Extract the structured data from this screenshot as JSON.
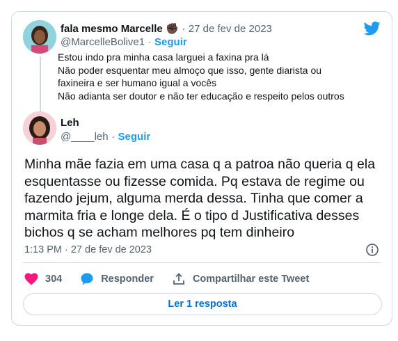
{
  "parent": {
    "name": "fala mesmo Marcelle",
    "emoji": "✊🏿",
    "date": "27 de fev de 2023",
    "handle": "@MarcelleBolive1",
    "follow": "Seguir",
    "lines": [
      "Estou indo pra minha casa larguei a faxina pra lá",
      "Não poder esquentar meu almoço que isso, gente diarista ou",
      "faxineira e ser humano igual a vocês",
      "Não adianta ser doutor e não ter educação e respeito pelos outros"
    ]
  },
  "main": {
    "name": "Leh",
    "handle": "@____leh",
    "follow": "Seguir",
    "lines": [
      "Minha mãe fazia em uma casa q a patroa não queria q ela",
      "esquentasse ou fizesse comida. Pq estava de regime ou",
      "fazendo jejum, alguma merda dessa. Tinha que comer a",
      "marmita fria e longe dela. É o tipo d Justificativa desses",
      "bichos q se acham melhores pq tem dinheiro"
    ],
    "timestamp": "1:13 PM · 27 de fev de 2023"
  },
  "actions": {
    "likes": "304",
    "reply": "Responder",
    "share": "Compartilhar este Tweet"
  },
  "read_replies": "Ler 1 resposta",
  "separator": "·",
  "colors": {
    "accent": "#1d9bf0",
    "like": "#f91880",
    "muted": "#536471",
    "border": "#cfd9de"
  },
  "icons": {
    "brand": "twitter-bird-icon",
    "like": "heart-icon",
    "reply": "speech-bubble-icon",
    "share": "share-upload-icon",
    "info": "info-icon"
  }
}
